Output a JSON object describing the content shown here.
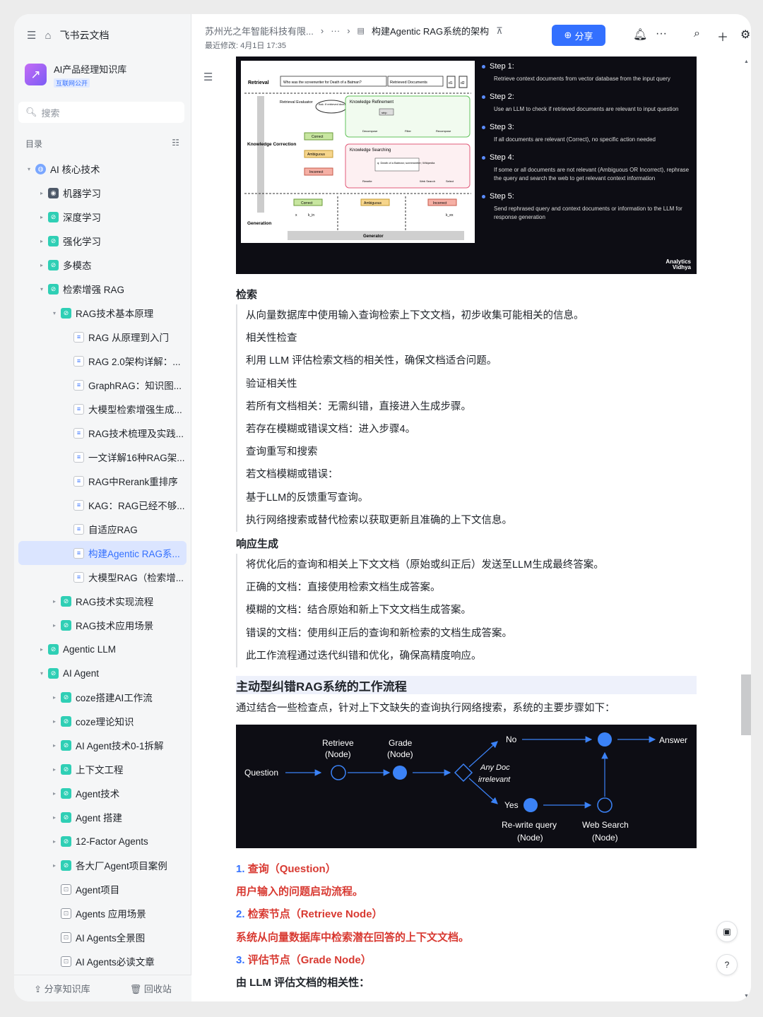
{
  "app": {
    "title": "飞书云文档"
  },
  "kb": {
    "name": "AI产品经理知识库",
    "tag": "互联网公开"
  },
  "search": {
    "placeholder": "搜索"
  },
  "toc": {
    "label": "目录"
  },
  "tree": [
    {
      "label": "AI 核心技术",
      "level": 0,
      "arrow": "▾",
      "icon": "globe"
    },
    {
      "label": "机器学习",
      "level": 1,
      "arrow": "▸",
      "icon": "robot"
    },
    {
      "label": "深度学习",
      "level": 1,
      "arrow": "▸",
      "icon": "folder"
    },
    {
      "label": "强化学习",
      "level": 1,
      "arrow": "▸",
      "icon": "folder"
    },
    {
      "label": "多模态",
      "level": 1,
      "arrow": "▸",
      "icon": "folder"
    },
    {
      "label": "检索增强 RAG",
      "level": 1,
      "arrow": "▾",
      "icon": "folder"
    },
    {
      "label": "RAG技术基本原理",
      "level": 2,
      "arrow": "▾",
      "icon": "folder"
    },
    {
      "label": "RAG 从原理到入门",
      "level": 3,
      "arrow": "",
      "icon": "doc"
    },
    {
      "label": "RAG 2.0架构详解：...",
      "level": 3,
      "arrow": "",
      "icon": "doc"
    },
    {
      "label": "GraphRAG：知识图...",
      "level": 3,
      "arrow": "",
      "icon": "doc"
    },
    {
      "label": "大模型检索增强生成...",
      "level": 3,
      "arrow": "",
      "icon": "doc"
    },
    {
      "label": "RAG技术梳理及实践...",
      "level": 3,
      "arrow": "",
      "icon": "doc"
    },
    {
      "label": "一文详解16种RAG架...",
      "level": 3,
      "arrow": "",
      "icon": "doc"
    },
    {
      "label": "RAG中Rerank重排序",
      "level": 3,
      "arrow": "",
      "icon": "doc"
    },
    {
      "label": "KAG：RAG已经不够...",
      "level": 3,
      "arrow": "",
      "icon": "doc"
    },
    {
      "label": "自适应RAG",
      "level": 3,
      "arrow": "",
      "icon": "doc"
    },
    {
      "label": "构建Agentic RAG系...",
      "level": 3,
      "arrow": "",
      "icon": "doc",
      "active": true
    },
    {
      "label": "大模型RAG（检索增...",
      "level": 3,
      "arrow": "",
      "icon": "doc"
    },
    {
      "label": "RAG技术实现流程",
      "level": 2,
      "arrow": "▸",
      "icon": "folder"
    },
    {
      "label": "RAG技术应用场景",
      "level": 2,
      "arrow": "▸",
      "icon": "folder"
    },
    {
      "label": "Agentic LLM",
      "level": 1,
      "arrow": "▸",
      "icon": "folder"
    },
    {
      "label": "AI Agent",
      "level": 1,
      "arrow": "▾",
      "icon": "folder"
    },
    {
      "label": "coze搭建AI工作流",
      "level": 2,
      "arrow": "▸",
      "icon": "folder"
    },
    {
      "label": "coze理论知识",
      "level": 2,
      "arrow": "▸",
      "icon": "folder"
    },
    {
      "label": "AI Agent技术0-1拆解",
      "level": 2,
      "arrow": "▸",
      "icon": "folder"
    },
    {
      "label": "上下文工程",
      "level": 2,
      "arrow": "▸",
      "icon": "folder"
    },
    {
      "label": "Agent技术",
      "level": 2,
      "arrow": "▸",
      "icon": "folder"
    },
    {
      "label": "Agent 搭建",
      "level": 2,
      "arrow": "▸",
      "icon": "folder"
    },
    {
      "label": "12-Factor Agents",
      "level": 2,
      "arrow": "▸",
      "icon": "folder"
    },
    {
      "label": "各大厂Agent项目案例",
      "level": 2,
      "arrow": "▸",
      "icon": "folder"
    },
    {
      "label": "Agent项目",
      "level": 2,
      "arrow": "",
      "icon": "ebox"
    },
    {
      "label": "Agents 应用场景",
      "level": 2,
      "arrow": "",
      "icon": "ebox"
    },
    {
      "label": "AI Agents全景图",
      "level": 2,
      "arrow": "",
      "icon": "ebox"
    },
    {
      "label": "AI Agents必读文章",
      "level": 2,
      "arrow": "",
      "icon": "ebox"
    }
  ],
  "footer": {
    "share": "分享知识库",
    "trash": "回收站"
  },
  "header": {
    "crumb_org": "苏州光之年智能科技有限...",
    "crumb_more": "···",
    "crumb_doc": "构建Agentic RAG系统的架构",
    "modified": "最近修改: 4月1日 17:35",
    "share_btn": "分享"
  },
  "fig1": {
    "diagram": {
      "retrieval": "Retrieval",
      "query": "Who was the screenwriter for Death of a Batman?",
      "retrieved_docs": "Retrieved Documents",
      "d1": "d1",
      "d2": "d2",
      "retrieval_evaluator": "Retrieval Evaluator",
      "ask": "Ask: If retrieved documents are correct to q?",
      "knowledge_correction": "Knowledge Correction",
      "knowledge_refinement": "Knowledge Refinement",
      "decompose": "Decompose",
      "filter": "Filter",
      "recompose": "Recompose",
      "strip": "strip",
      "correct": "Correct",
      "ambiguous": "Ambiguous",
      "incorrect": "Incorrect",
      "knowledge_searching": "Knowledge Searching",
      "search_query": "q: Death of a Batman; screenwriter; Wikipedia",
      "rewrite": "Rewrite",
      "web_search": "Web Search",
      "select": "Select",
      "generation": "Generation",
      "generator": "Generator",
      "x": "x",
      "k_in": "k_in",
      "k_ex": "k_ex"
    },
    "steps": [
      {
        "title": "Step 1:",
        "desc": "Retrieve context documents from vector database from the input query"
      },
      {
        "title": "Step 2:",
        "desc": "Use an LLM to check if retrieved documents are relevant to input question"
      },
      {
        "title": "Step 3:",
        "desc": "If all documents are relevant (Correct), no specific action needed"
      },
      {
        "title": "Step 4:",
        "desc": "If some or all documents are not relevant (Ambiguous OR Incorrect), rephrase the query and search the web to get relevant context information"
      },
      {
        "title": "Step 5:",
        "desc": "Send rephrased query and context documents or information to the LLM for response generation"
      }
    ],
    "brand_line1": "Analytics",
    "brand_line2": "Vidhya"
  },
  "sec_retrieve": {
    "title": "检索",
    "lines": [
      "从向量数据库中使用输入查询检索上下文文档，初步收集可能相关的信息。",
      "相关性检查",
      "利用 LLM 评估检索文档的相关性，确保文档适合问题。",
      "验证相关性",
      "若所有文档相关：无需纠错，直接进入生成步骤。",
      "若存在模糊或错误文档：进入步骤4。",
      "查询重写和搜索",
      "若文档模糊或错误：",
      "基于LLM的反馈重写查询。",
      "执行网络搜索或替代检索以获取更新且准确的上下文信息。"
    ]
  },
  "sec_gen": {
    "title": "响应生成",
    "lines": [
      "将优化后的查询和相关上下文文档（原始或纠正后）发送至LLM生成最终答案。",
      "正确的文档：直接使用检索文档生成答案。",
      "模糊的文档：结合原始和新上下文文档生成答案。",
      "错误的文档：使用纠正后的查询和新检索的文档生成答案。",
      "此工作流程通过迭代纠错和优化，确保高精度响应。"
    ]
  },
  "sec_flow": {
    "title": "主动型纠错RAG系统的工作流程",
    "intro": "通过结合一些检查点，针对上下文缺失的查询执行网络搜索，系统的主要步骤如下："
  },
  "fig2": {
    "question": "Question",
    "retrieve": "Retrieve",
    "retrieve_sub": "(Node)",
    "grade": "Grade",
    "grade_sub": "(Node)",
    "no": "No",
    "yes": "Yes",
    "anydoc1": "Any Doc",
    "anydoc2": "irrelevant",
    "answer": "Answer",
    "rewrite": "Re-write query",
    "rewrite_sub": "(Node)",
    "websearch": "Web Search",
    "websearch_sub": "(Node)"
  },
  "ordered": {
    "n1": "1.",
    "t1": "查询（Question）",
    "d1": "用户输入的问题启动流程。",
    "n2": "2.",
    "t2": "检索节点（Retrieve Node）",
    "d2": "系统从向量数据库中检索潜在回答的上下文文档。",
    "n3": "3.",
    "t3": "评估节点（Grade Node）",
    "d3": "由 LLM 评估文档的相关性："
  }
}
